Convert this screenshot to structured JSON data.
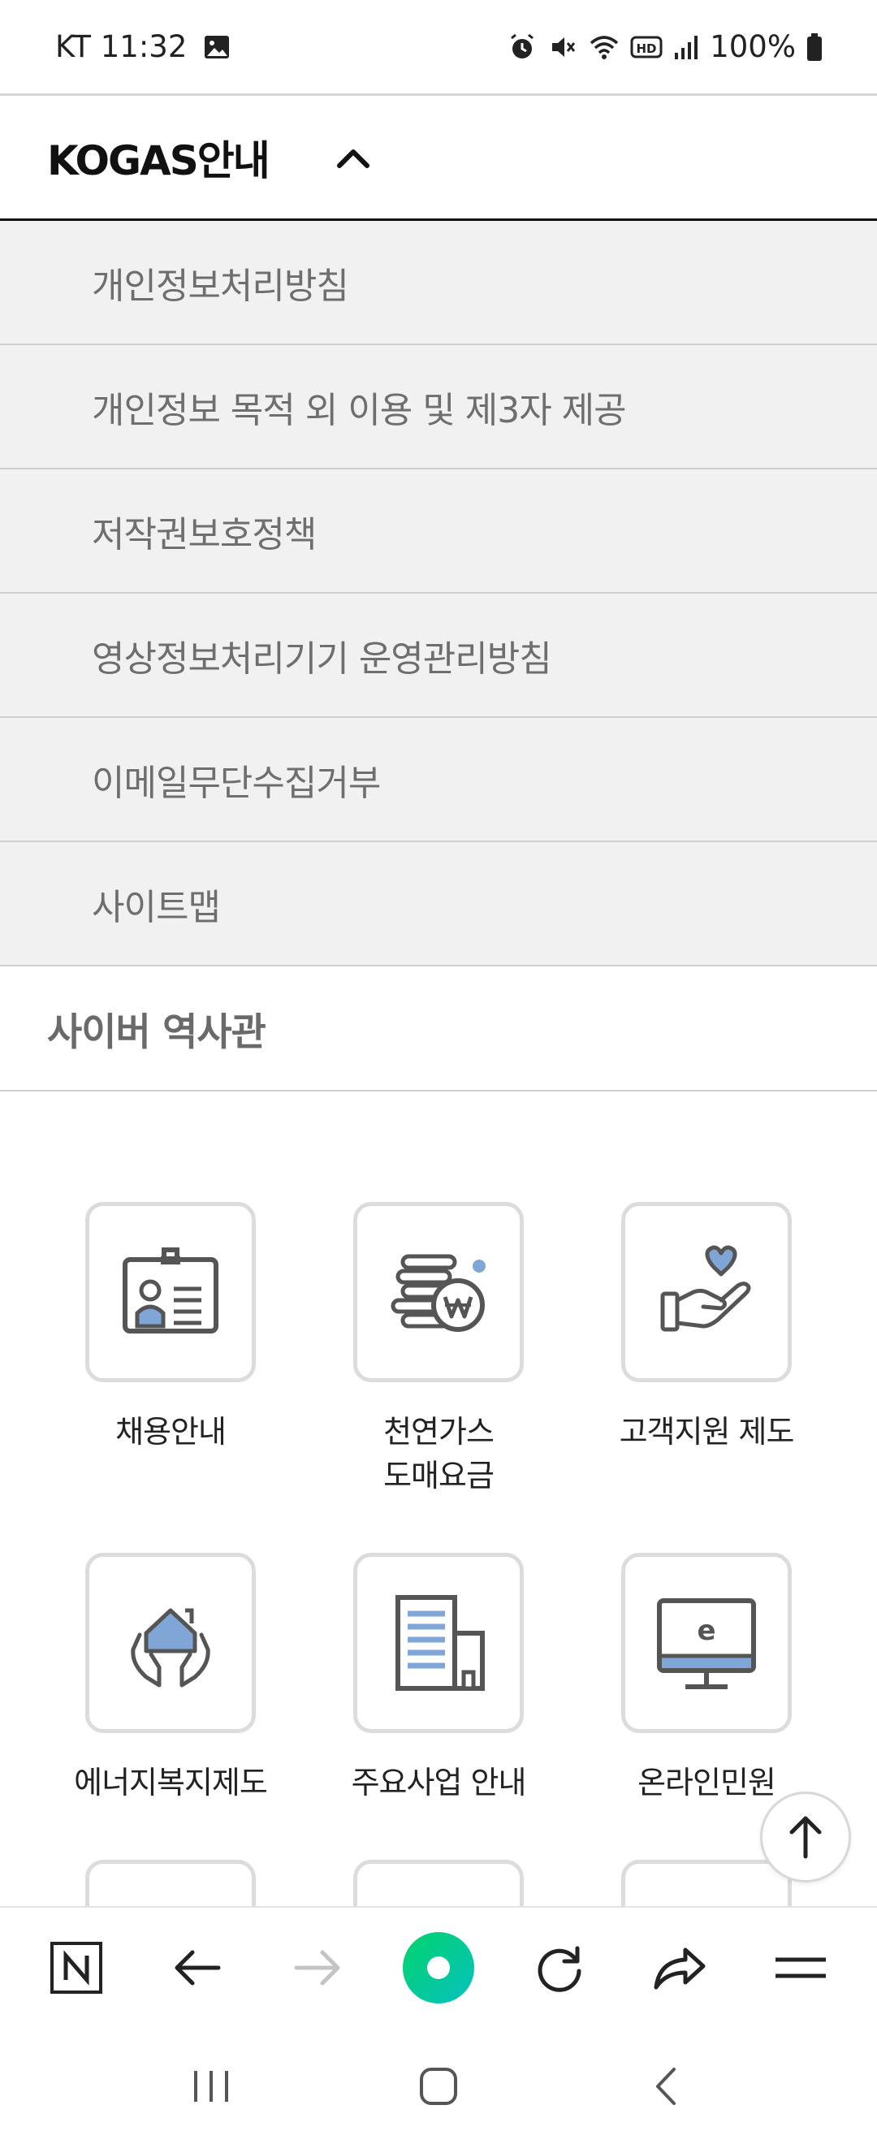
{
  "status_bar": {
    "carrier_time": "KT 11:32",
    "battery": "100%"
  },
  "accordion": {
    "title": "KOGAS안내",
    "items": [
      {
        "label": "개인정보처리방침"
      },
      {
        "label": "개인정보 목적 외 이용 및 제3자 제공"
      },
      {
        "label": "저작권보호정책"
      },
      {
        "label": "영상정보처리기기 운영관리방침"
      },
      {
        "label": "이메일무단수집거부"
      },
      {
        "label": "사이트맵"
      }
    ]
  },
  "cyber_museum": {
    "label": "사이버 역사관"
  },
  "quick_menu": [
    {
      "label": "채용안내",
      "icon": "id-card-icon"
    },
    {
      "label": "천연가스\n도매요금",
      "icon": "coins-won-icon"
    },
    {
      "label": "고객지원 제도",
      "icon": "heart-hand-icon"
    },
    {
      "label": "에너지복지제도",
      "icon": "house-hands-icon"
    },
    {
      "label": "주요사업 안내",
      "icon": "building-icon"
    },
    {
      "label": "온라인민원",
      "icon": "monitor-e-icon"
    }
  ],
  "colors": {
    "accent_blue": "#7fa6d6",
    "naver_green": "#03c75a",
    "submenu_bg": "#f1f1f1"
  }
}
